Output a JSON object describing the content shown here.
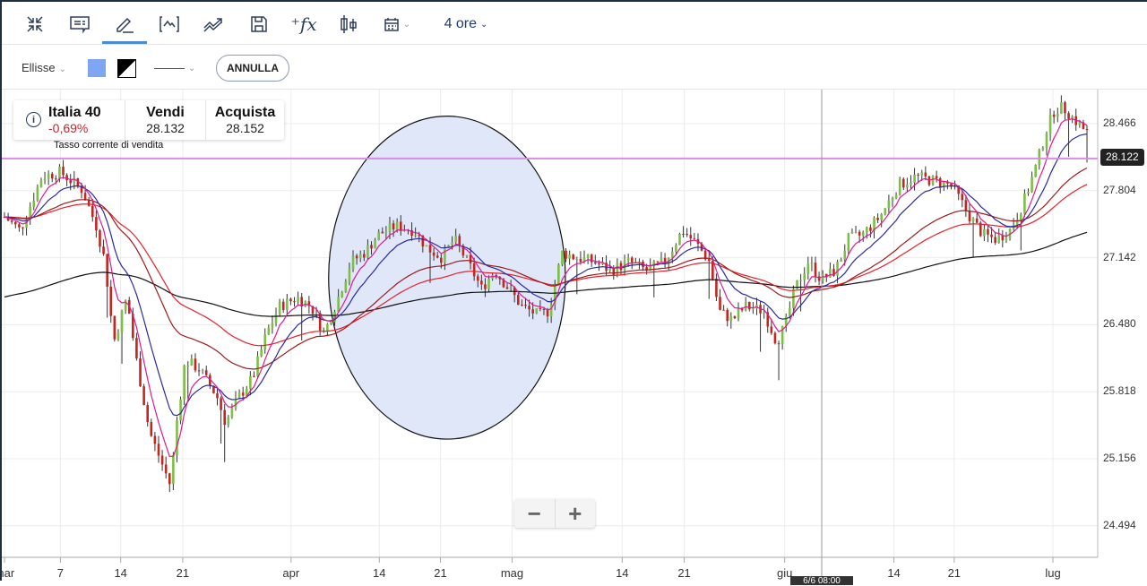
{
  "toolbar": {
    "items": [
      {
        "icon": "collapse-icon"
      },
      {
        "icon": "comment-icon"
      },
      {
        "icon": "pencil-icon"
      },
      {
        "icon": "indicator-icon"
      },
      {
        "icon": "trend-icon"
      },
      {
        "icon": "save-icon"
      },
      {
        "icon": "function-icon"
      },
      {
        "icon": "candlestick-icon"
      },
      {
        "icon": "calendar-icon"
      }
    ],
    "timeframe": "4 ore"
  },
  "drawbar": {
    "shape": "Ellisse",
    "fill_color": "#7ea6f2",
    "annulla": "ANNULLA"
  },
  "instrument": {
    "name": "Italia 40",
    "change": "-0,69%",
    "sell_label": "Vendi",
    "sell": "28.132",
    "buy_label": "Acquista",
    "buy": "28.152",
    "note": "Tasso corrente di vendita"
  },
  "current_price": "28.122",
  "crosshair_label": "6/6 08:00",
  "zoom": {
    "minus": "−",
    "plus": "+"
  },
  "chart_data": {
    "type": "candlestick",
    "y_ticks": [
      "28.466",
      "27.804",
      "27.142",
      "26.480",
      "25.818",
      "25.156",
      "24.494"
    ],
    "ylim": [
      24.3,
      28.75
    ],
    "x_ticks": [
      {
        "label": "mar",
        "day": 0
      },
      {
        "label": "7",
        "day": 6.4
      },
      {
        "label": "14",
        "day": 13.3
      },
      {
        "label": "21",
        "day": 20.4
      },
      {
        "label": "apr",
        "day": 32.8
      },
      {
        "label": "14",
        "day": 42.9
      },
      {
        "label": "21",
        "day": 49.9
      },
      {
        "label": "mag",
        "day": 58.1
      },
      {
        "label": "14",
        "day": 70.7
      },
      {
        "label": "21",
        "day": 77.8
      },
      {
        "label": "giu",
        "day": 89.3
      },
      {
        "label": "14",
        "day": 101.8
      },
      {
        "label": "21",
        "day": 108.7
      },
      {
        "label": "lug",
        "day": 120
      }
    ],
    "price_path": [
      [
        0,
        27.546
      ],
      [
        1.8,
        27.413
      ],
      [
        4.3,
        27.944
      ],
      [
        6.4,
        27.988
      ],
      [
        8.9,
        27.811
      ],
      [
        10.5,
        27.457
      ],
      [
        11.5,
        27.103
      ],
      [
        12.5,
        26.307
      ],
      [
        14,
        26.749
      ],
      [
        15.1,
        26.13
      ],
      [
        16.6,
        25.422
      ],
      [
        18.2,
        25.068
      ],
      [
        19,
        24.891
      ],
      [
        19.7,
        25.51
      ],
      [
        20.7,
        26.13
      ],
      [
        22.3,
        26.041
      ],
      [
        24.3,
        25.776
      ],
      [
        25.3,
        25.51
      ],
      [
        26.9,
        25.776
      ],
      [
        28.4,
        25.953
      ],
      [
        30,
        26.395
      ],
      [
        31.5,
        26.661
      ],
      [
        33.5,
        26.749
      ],
      [
        35.1,
        26.661
      ],
      [
        36.6,
        26.395
      ],
      [
        38.2,
        26.749
      ],
      [
        39.7,
        27.103
      ],
      [
        41.2,
        27.192
      ],
      [
        42.8,
        27.369
      ],
      [
        44.8,
        27.457
      ],
      [
        46.9,
        27.413
      ],
      [
        48.4,
        27.236
      ],
      [
        50,
        27.147
      ],
      [
        51.5,
        27.324
      ],
      [
        53,
        27.103
      ],
      [
        54.6,
        26.838
      ],
      [
        56.1,
        27.015
      ],
      [
        57.7,
        26.838
      ],
      [
        59.2,
        26.661
      ],
      [
        61.2,
        26.572
      ],
      [
        62.3,
        26.616
      ],
      [
        63.8,
        27.192
      ],
      [
        65.3,
        27.147
      ],
      [
        67.4,
        27.103
      ],
      [
        69.4,
        27.015
      ],
      [
        71.5,
        27.103
      ],
      [
        73.5,
        27.015
      ],
      [
        75.6,
        27.103
      ],
      [
        77.6,
        27.413
      ],
      [
        79.2,
        27.28
      ],
      [
        80.7,
        27.103
      ],
      [
        81.8,
        26.616
      ],
      [
        83.3,
        26.528
      ],
      [
        84.8,
        26.661
      ],
      [
        86.9,
        26.616
      ],
      [
        88.4,
        26.307
      ],
      [
        89.4,
        26.484
      ],
      [
        90.5,
        26.838
      ],
      [
        92,
        27.103
      ],
      [
        93.5,
        26.926
      ],
      [
        95.1,
        27.015
      ],
      [
        96.6,
        27.324
      ],
      [
        98.2,
        27.369
      ],
      [
        100.2,
        27.546
      ],
      [
        102.3,
        27.855
      ],
      [
        104.3,
        27.944
      ],
      [
        106.4,
        27.9
      ],
      [
        108.4,
        27.855
      ],
      [
        110.5,
        27.546
      ],
      [
        112,
        27.369
      ],
      [
        113.5,
        27.324
      ],
      [
        115.1,
        27.413
      ],
      [
        116.6,
        27.678
      ],
      [
        118.2,
        28.077
      ],
      [
        119.2,
        28.386
      ],
      [
        120.2,
        28.608
      ],
      [
        121.2,
        28.625
      ],
      [
        122.8,
        28.475
      ],
      [
        124.3,
        28.342
      ]
    ],
    "horizontal_line": 28.122,
    "moving_averages": [
      {
        "color": "#e0198f",
        "period": 6
      },
      {
        "color": "#2a2aa0",
        "period": 14
      },
      {
        "color": "#a01a1a",
        "period": 40
      },
      {
        "color": "#e8202a",
        "period": 60
      },
      {
        "color": "#111111",
        "period": 180
      }
    ],
    "ellipse": {
      "start_day": 37.1,
      "end_day": 64.2,
      "top_price": 28.54,
      "bottom_price": 25.35,
      "fill": "#dfe7f8"
    }
  }
}
